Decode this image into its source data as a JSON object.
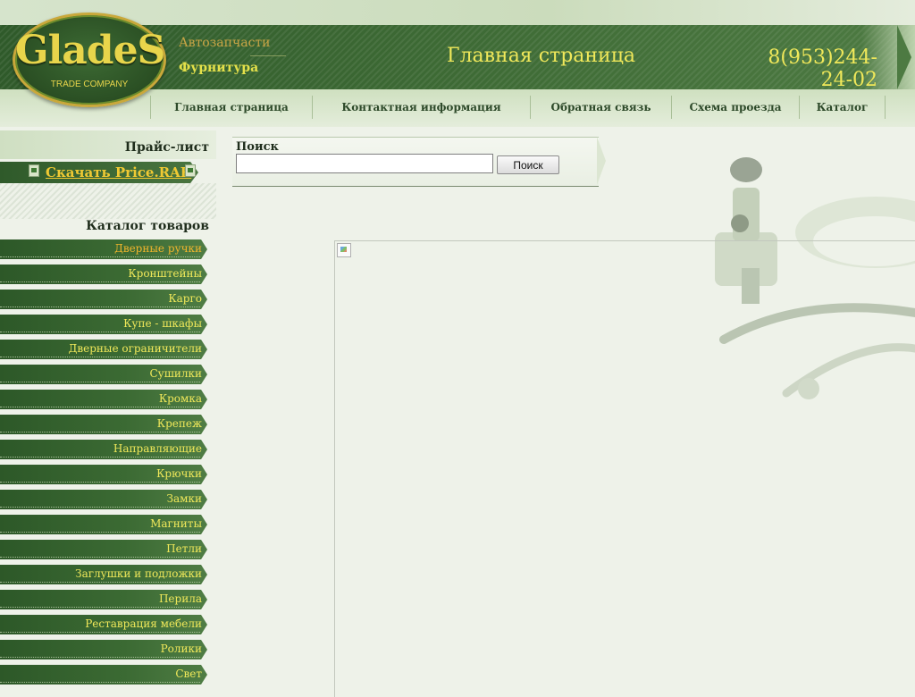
{
  "logo": {
    "word": "GladeS",
    "subtitle": "TRADE COMPANY"
  },
  "header": {
    "tagline_1": "Автозапчасти",
    "tagline_2": "Фурнитура",
    "page_title": "Главная страница",
    "phone_line_1": "8(953)244-",
    "phone_line_2": "24-02"
  },
  "nav": {
    "items": [
      {
        "label": "Главная страница"
      },
      {
        "label": "Контактная информация"
      },
      {
        "label": "Обратная связь"
      },
      {
        "label": "Схема проезда"
      },
      {
        "label": "Каталог"
      }
    ]
  },
  "sidebar": {
    "price_title": "Прайс-лист",
    "download_label": "Скачать Price.RAR",
    "catalog_title": "Каталог товаров",
    "categories": [
      {
        "label": "Дверные ручки",
        "active": true
      },
      {
        "label": "Кронштейны"
      },
      {
        "label": "Карго"
      },
      {
        "label": "Купе - шкафы"
      },
      {
        "label": "Дверные ограничители"
      },
      {
        "label": "Сушилки"
      },
      {
        "label": "Кромка"
      },
      {
        "label": "Крепеж"
      },
      {
        "label": "Направляющие"
      },
      {
        "label": "Крючки"
      },
      {
        "label": "Замки"
      },
      {
        "label": "Магниты"
      },
      {
        "label": "Петли"
      },
      {
        "label": "Заглушки и подложки"
      },
      {
        "label": "Перила"
      },
      {
        "label": "Реставрация мебели"
      },
      {
        "label": "Ролики"
      },
      {
        "label": "Свет"
      }
    ]
  },
  "search": {
    "label": "Поиск",
    "value": "",
    "button_label": "Поиск"
  },
  "colors": {
    "header_green": "#2f5a2a",
    "accent_yellow": "#f0e85a",
    "active_orange": "#f0b52c",
    "page_background": "#eef2e9"
  },
  "icons": {
    "download_file": "rar-file-icon",
    "broken_image": "broken-image-icon"
  }
}
